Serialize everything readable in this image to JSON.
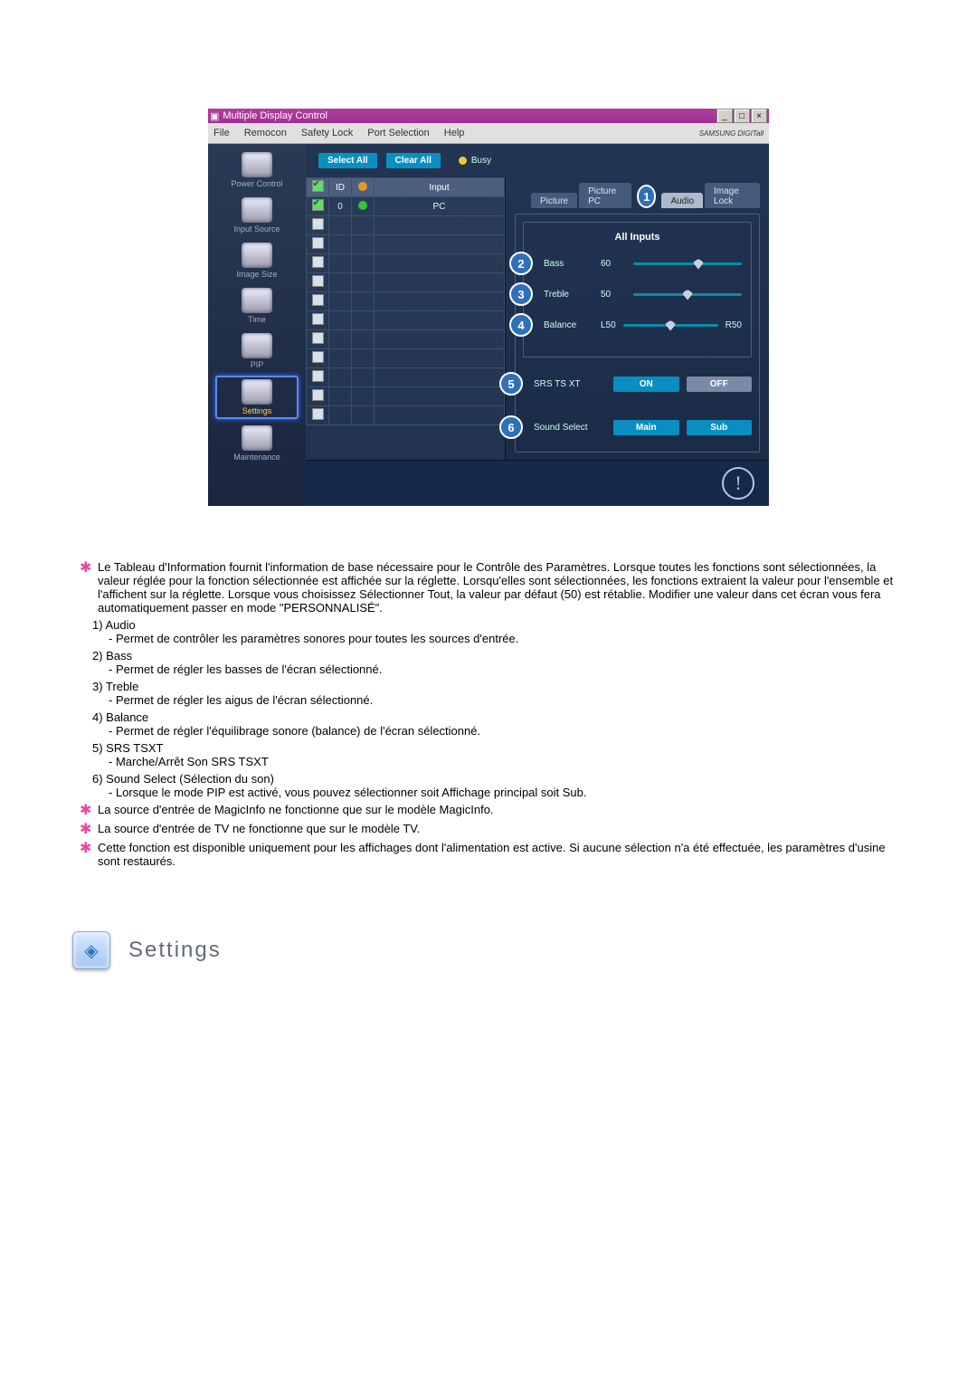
{
  "window": {
    "title": "Multiple Display Control"
  },
  "menu": {
    "file": "File",
    "remocon": "Remocon",
    "safety": "Safety Lock",
    "port": "Port Selection",
    "help": "Help",
    "brand": "SAMSUNG DIGITall"
  },
  "sidebar": {
    "items": [
      {
        "label": "Power Control"
      },
      {
        "label": "Input Source"
      },
      {
        "label": "Image Size"
      },
      {
        "label": "Time"
      },
      {
        "label": "PIP"
      },
      {
        "label": "Settings"
      },
      {
        "label": "Maintenance"
      }
    ]
  },
  "toolbar": {
    "select_all": "Select All",
    "clear_all": "Clear All",
    "busy": "Busy"
  },
  "grid": {
    "hdr_id": "ID",
    "hdr_input": "Input",
    "row0": {
      "id": "0",
      "input": "PC"
    }
  },
  "tabs": {
    "picture": "Picture",
    "picturepc": "Picture PC",
    "audio": "Audio",
    "imagelock": "Image Lock",
    "marker": "1"
  },
  "audio": {
    "all_inputs": "All Inputs",
    "bass": {
      "label": "Bass",
      "value": "60",
      "marker": "2"
    },
    "treble": {
      "label": "Treble",
      "value": "50",
      "marker": "3"
    },
    "balance": {
      "label": "Balance",
      "left": "L50",
      "right": "R50",
      "marker": "4"
    },
    "srs": {
      "label": "SRS TS XT",
      "on": "ON",
      "off": "OFF",
      "marker": "5"
    },
    "soundsel": {
      "label": "Sound Select",
      "main": "Main",
      "sub": "Sub",
      "marker": "6"
    }
  },
  "notes": {
    "star1": "Le Tableau d'Information fournit l'information de base nécessaire pour le Contrôle des Paramètres. Lorsque toutes les fonctions sont sélectionnées, la valeur réglée pour la fonction sélectionnée est affichée sur la réglette. Lorsqu'elles sont sélectionnées, les fonctions extraient la valeur pour l'ensemble et l'affichent sur la réglette. Lorsque vous choisissez Sélectionner Tout, la valeur par défaut (50) est rétablie. Modifier une valeur dans cet écran vous fera automatiquement passer en mode \"PERSONNALISÉ\".",
    "n1_t": "1)  Audio",
    "n1_d": "- Permet de contrôler les paramètres sonores pour toutes les sources d'entrée.",
    "n2_t": "2)  Bass",
    "n2_d": "- Permet de régler les basses de l'écran sélectionné.",
    "n3_t": "3)  Treble",
    "n3_d": "- Permet de régler les aigus de l'écran sélectionné.",
    "n4_t": "4)  Balance",
    "n4_d": "- Permet de régler l'équilibrage sonore (balance) de l'écran sélectionné.",
    "n5_t": "5)  SRS TSXT",
    "n5_d": "- Marche/Arrêt Son SRS TSXT",
    "n6_t": "6)  Sound Select (Sélection du son)",
    "n6_d": "- Lorsque le mode PIP est activé, vous pouvez sélectionner soit Affichage principal soit Sub.",
    "star2": "La source d'entrée de MagicInfo ne fonctionne que sur le modèle MagicInfo.",
    "star3": "La source d'entrée de TV ne fonctionne que sur le modèle TV.",
    "star4": "Cette fonction est disponible uniquement pour les affichages dont l'alimentation est active. Si aucune sélection n'a été effectuée, les paramètres d'usine sont restaurés."
  },
  "footer": {
    "settings": "Settings"
  }
}
